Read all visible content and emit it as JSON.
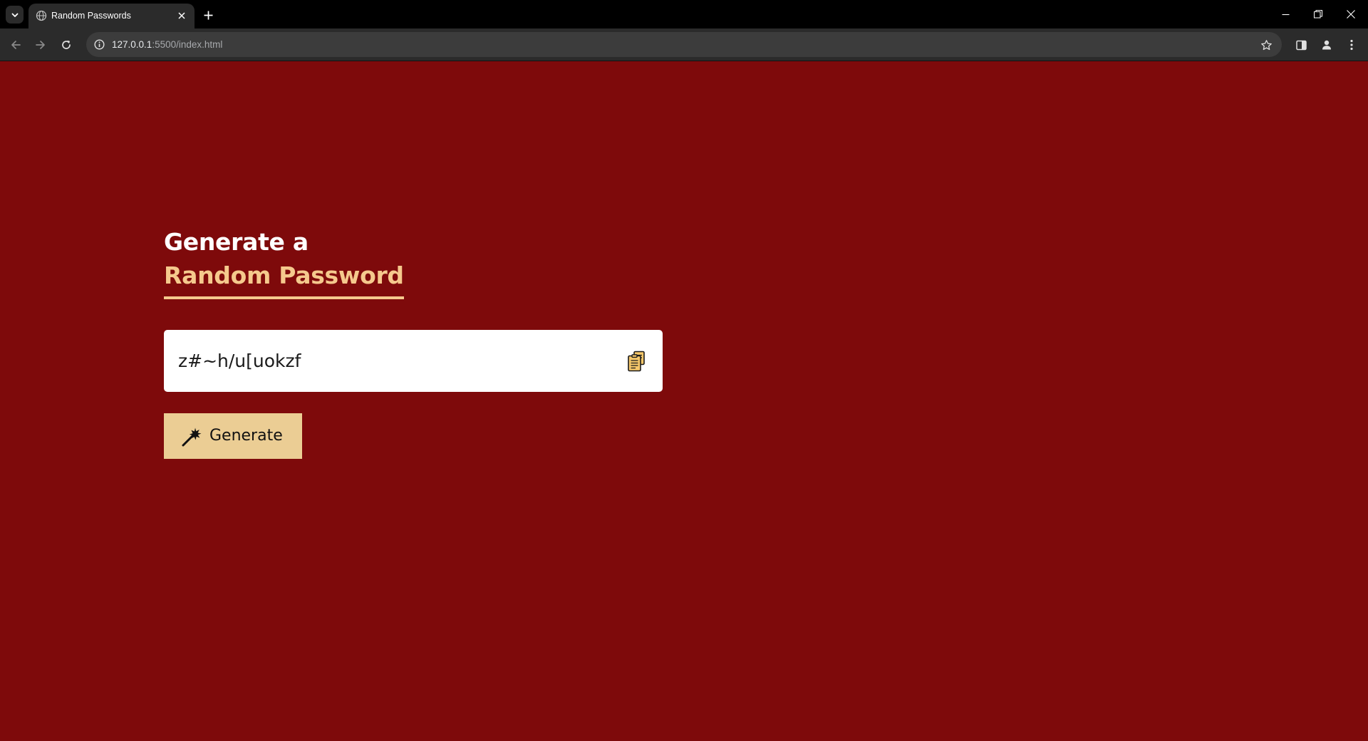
{
  "browser": {
    "tab_title": "Random Passwords",
    "url_host": "127.0.0.1",
    "url_path": ":5500/index.html"
  },
  "page": {
    "heading_line1": "Generate a",
    "heading_line2": "Random Password",
    "password_value": "z#~h/u[uokzf",
    "generate_label": "Generate"
  },
  "colors": {
    "page_background": "#7e0a0b",
    "accent": "#f5c98d",
    "button_background": "#ebcd94",
    "input_background": "#ffffff"
  },
  "icons": {
    "copy": "clipboard-copy-icon",
    "generate": "magic-wand-icon"
  }
}
